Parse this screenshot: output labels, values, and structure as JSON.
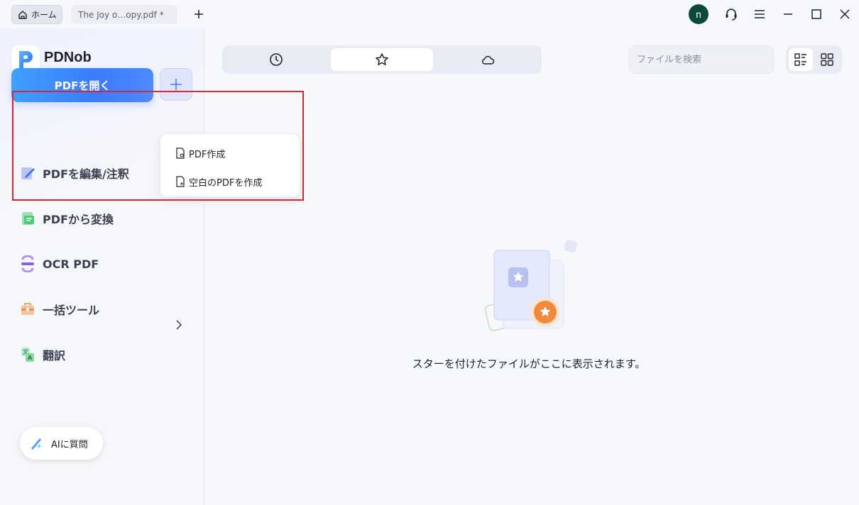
{
  "titlebar": {
    "tabs": [
      {
        "label": "ホーム",
        "icon": "home-icon"
      },
      {
        "label": "The Joy o…opy.pdf *"
      }
    ],
    "avatar_letter": "n"
  },
  "sidebar": {
    "brand": "PDNob",
    "open_button": "PDFを開く",
    "items": [
      {
        "label": "PDFを編集/注釈",
        "icon": "edit-icon"
      },
      {
        "label": "PDFから変換",
        "icon": "convert-icon"
      },
      {
        "label": "OCR PDF",
        "icon": "ocr-icon"
      },
      {
        "label": "一括ツール",
        "icon": "toolbox-icon"
      },
      {
        "label": "翻訳",
        "icon": "translate-icon"
      }
    ],
    "ai_button": "AIに質問"
  },
  "dropdown": {
    "items": [
      {
        "label": "PDF作成",
        "icon": "file-create-icon"
      },
      {
        "label": "空白のPDFを作成",
        "icon": "file-blank-icon"
      }
    ]
  },
  "main": {
    "tabs": [
      {
        "icon": "clock-icon",
        "active": false
      },
      {
        "icon": "star-icon",
        "active": true
      },
      {
        "icon": "cloud-icon",
        "active": false
      }
    ],
    "search_placeholder": "ファイルを検索",
    "view_modes": [
      {
        "icon": "list-view-icon",
        "active": true
      },
      {
        "icon": "grid-view-icon",
        "active": false
      }
    ],
    "empty_message": "スターを付けたファイルがここに表示されます。"
  },
  "colors": {
    "accent": "#3a7bff",
    "highlight_border": "#e0242b",
    "avatar": "#0b4a3a",
    "star_badge": "#f08a3c"
  }
}
